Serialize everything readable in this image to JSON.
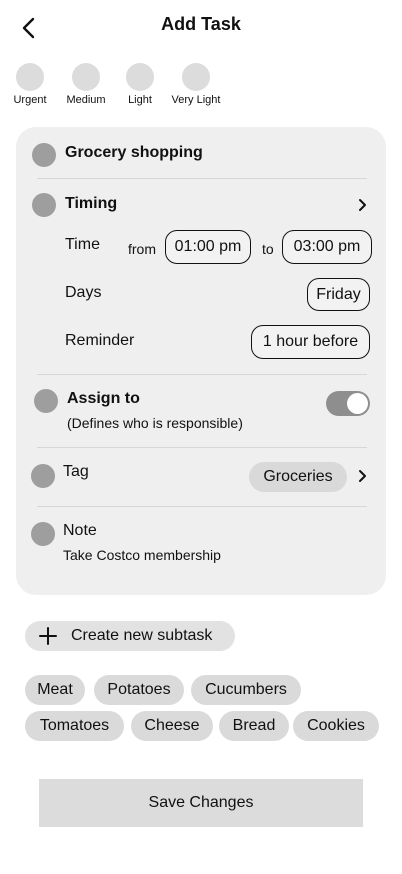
{
  "header": {
    "title": "Add Task",
    "back_icon": "chevron-left-icon"
  },
  "priorities": [
    {
      "label": "Urgent"
    },
    {
      "label": "Medium"
    },
    {
      "label": "Light"
    },
    {
      "label": "Very Light"
    }
  ],
  "task": {
    "name": "Grocery shopping",
    "timing": {
      "label": "Timing",
      "time_label": "Time",
      "from_label": "from",
      "from_value": "01:00 pm",
      "to_label": "to",
      "to_value": "03:00 pm",
      "days_label": "Days",
      "days_value": "Friday",
      "reminder_label": "Reminder",
      "reminder_value": "1 hour before"
    },
    "assign": {
      "label": "Assign to",
      "description": "(Defines who is responsible)",
      "toggle_on": true
    },
    "tag": {
      "label": "Tag",
      "value": "Groceries"
    },
    "note": {
      "label": "Note",
      "value": "Take Costco membership"
    }
  },
  "subtask": {
    "create_label": "Create new subtask"
  },
  "chips": [
    "Meat",
    "Potatoes",
    "Cucumbers",
    "Tomatoes",
    "Cheese",
    "Bread",
    "Cookies"
  ],
  "actions": {
    "save_label": "Save Changes"
  },
  "colors": {
    "card_bg": "#efefef",
    "dot": "#9e9e9e",
    "toggle_track": "#8e8e8e"
  }
}
